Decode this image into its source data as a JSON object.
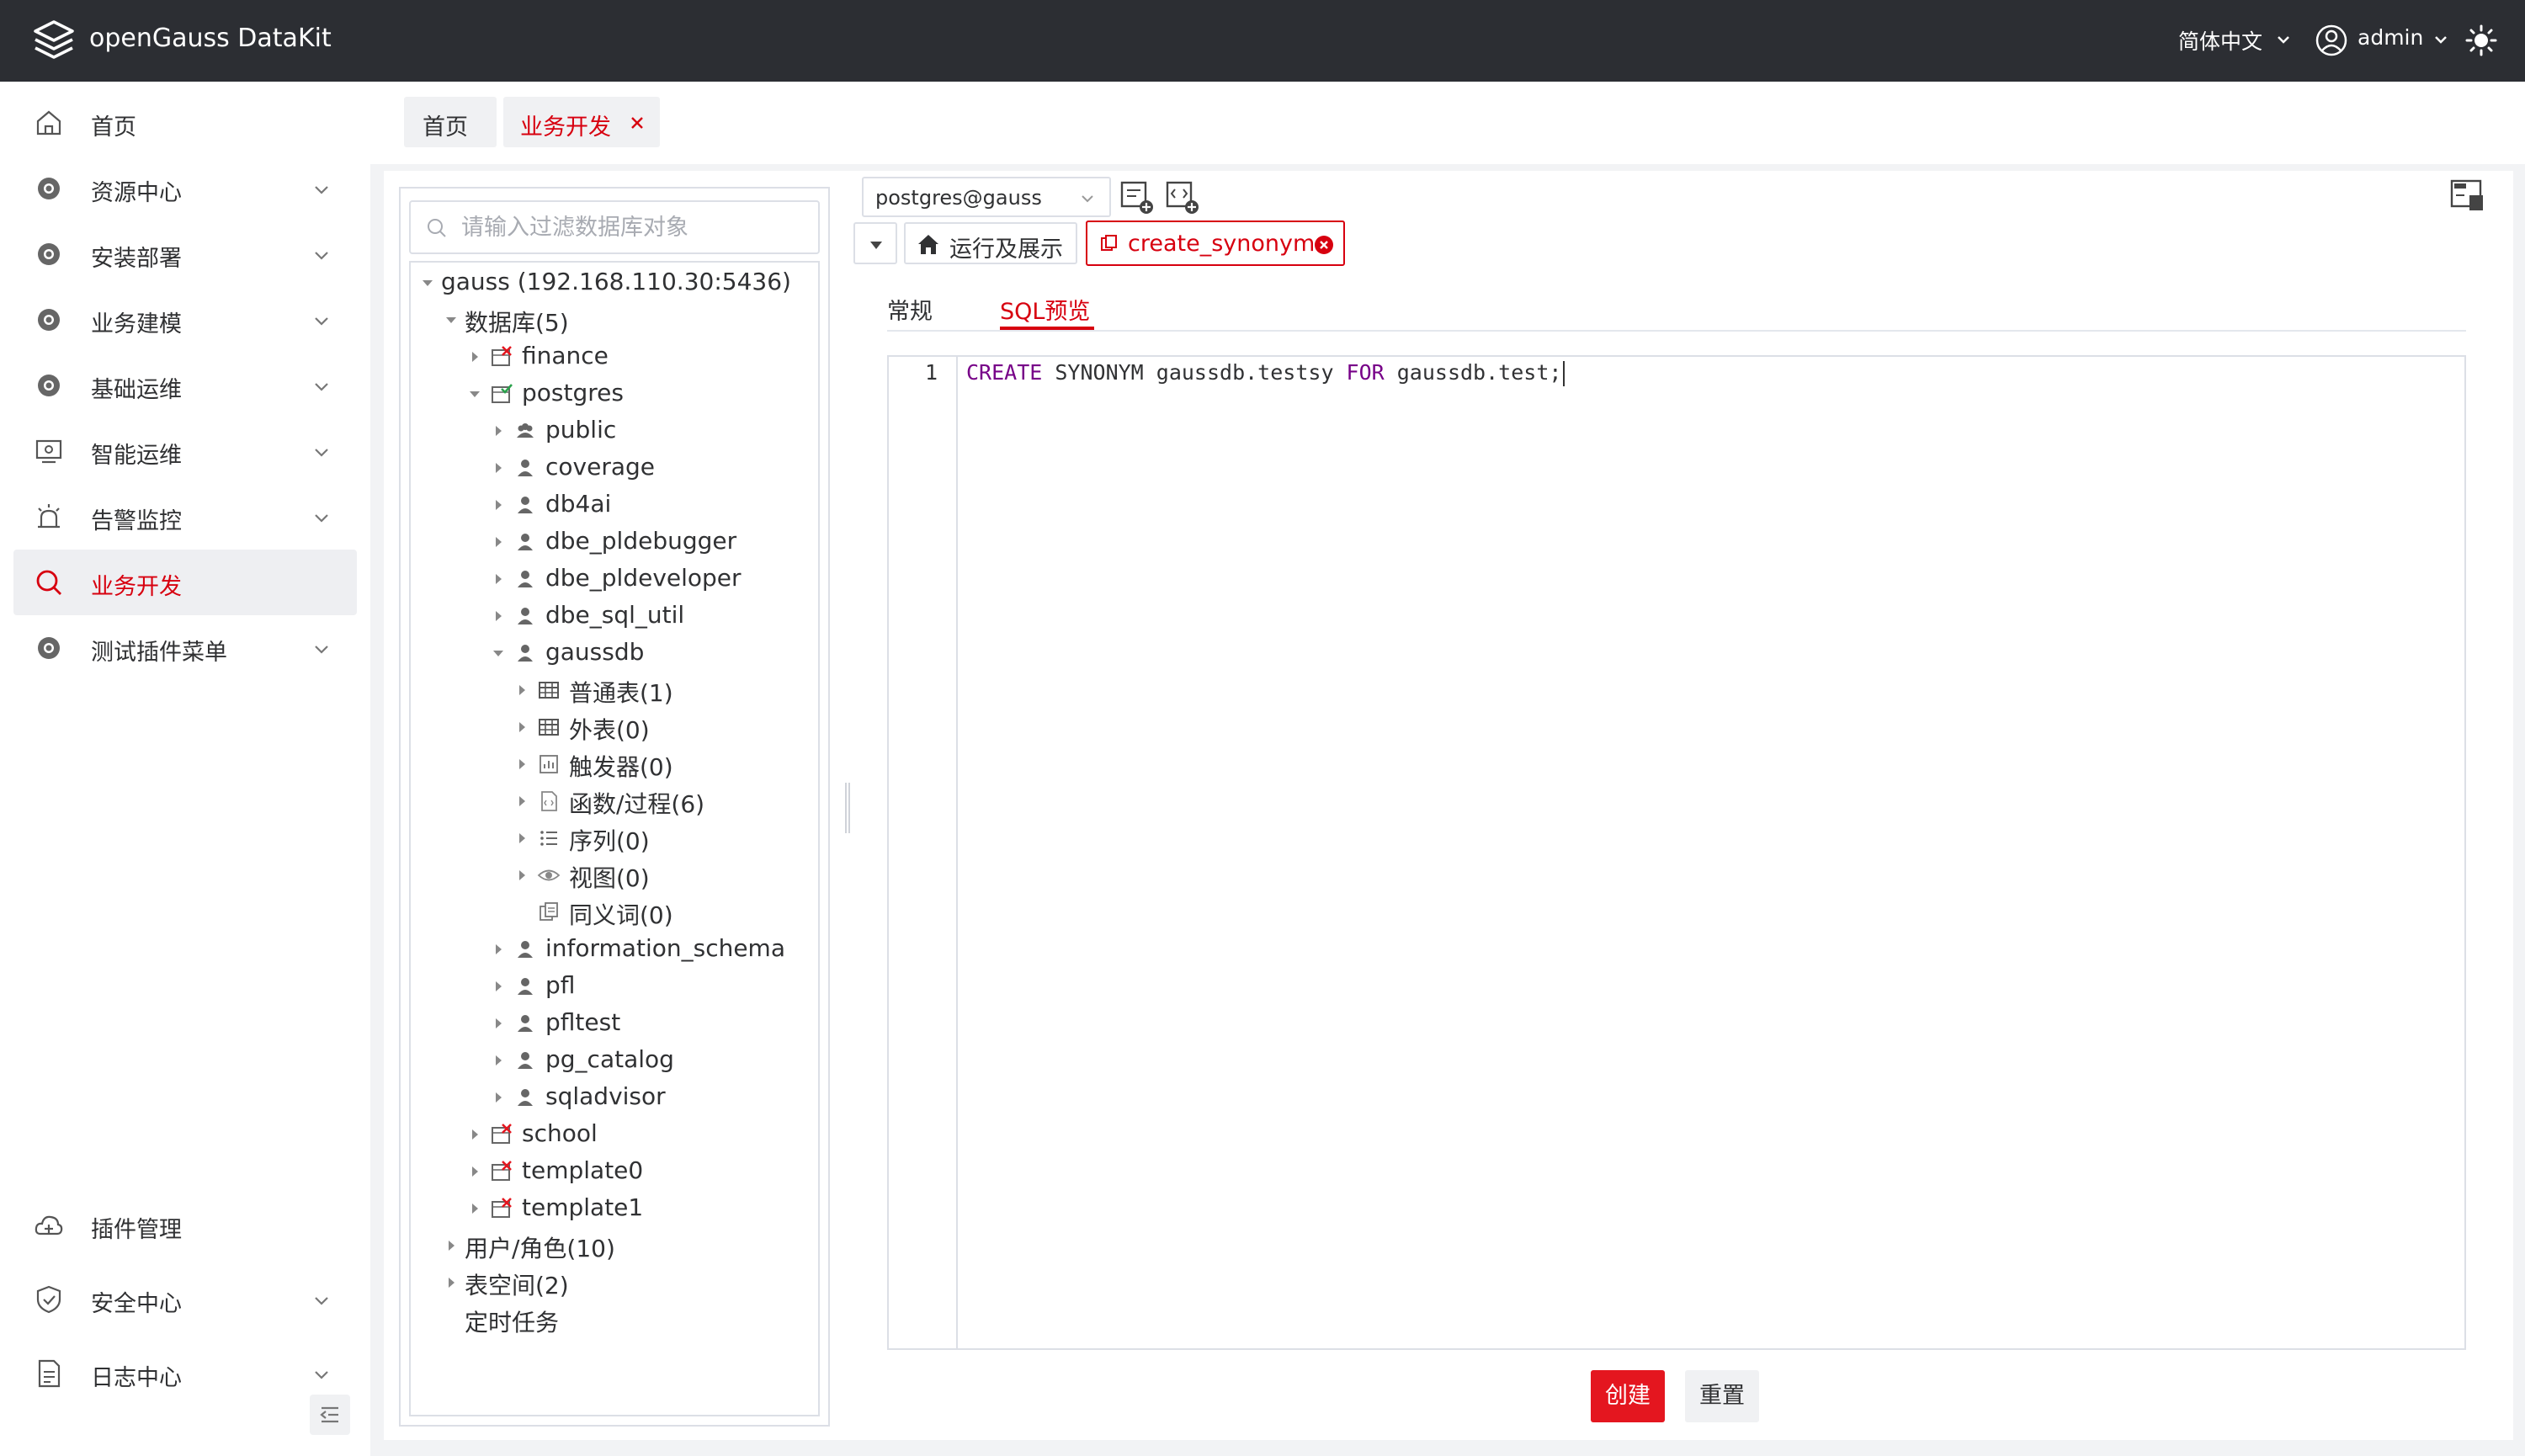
{
  "app": {
    "title": "openGauss DataKit"
  },
  "header": {
    "language": "简体中文",
    "user": "admin"
  },
  "sidebar": {
    "items": [
      {
        "label": "首页",
        "icon": "home-icon"
      },
      {
        "label": "资源中心",
        "icon": "gear-icon"
      },
      {
        "label": "安装部署",
        "icon": "gear-icon"
      },
      {
        "label": "业务建模",
        "icon": "gear-icon"
      },
      {
        "label": "基础运维",
        "icon": "gear-icon"
      },
      {
        "label": "智能运维",
        "icon": "monitor-icon"
      },
      {
        "label": "告警监控",
        "icon": "alarm-icon"
      },
      {
        "label": "业务开发",
        "icon": "search-icon"
      },
      {
        "label": "测试插件菜单",
        "icon": "gear-icon"
      }
    ],
    "bottom_items": [
      {
        "label": "插件管理",
        "icon": "cloud-icon"
      },
      {
        "label": "安全中心",
        "icon": "shield-icon"
      },
      {
        "label": "日志中心",
        "icon": "document-icon"
      }
    ],
    "active": "业务开发"
  },
  "page_tabs": [
    {
      "label": "首页"
    },
    {
      "label": "业务开发"
    }
  ],
  "tree": {
    "search_placeholder": "请输入过滤数据库对象",
    "nodes": [
      {
        "label": "gauss (192.168.110.30:5436)"
      },
      {
        "label": "数据库(5)"
      },
      {
        "label": "finance"
      },
      {
        "label": "postgres"
      },
      {
        "label": "public"
      },
      {
        "label": "coverage"
      },
      {
        "label": "db4ai"
      },
      {
        "label": "dbe_pldebugger"
      },
      {
        "label": "dbe_pldeveloper"
      },
      {
        "label": "dbe_sql_util"
      },
      {
        "label": "gaussdb"
      },
      {
        "label": "普通表(1)"
      },
      {
        "label": "外表(0)"
      },
      {
        "label": "触发器(0)"
      },
      {
        "label": "函数/过程(6)"
      },
      {
        "label": "序列(0)"
      },
      {
        "label": "视图(0)"
      },
      {
        "label": "同义词(0)"
      },
      {
        "label": "information_schema"
      },
      {
        "label": "pfl"
      },
      {
        "label": "pfltest"
      },
      {
        "label": "pg_catalog"
      },
      {
        "label": "sqladvisor"
      },
      {
        "label": "school"
      },
      {
        "label": "template0"
      },
      {
        "label": "template1"
      },
      {
        "label": "用户/角色(10)"
      },
      {
        "label": "表空间(2)"
      },
      {
        "label": "定时任务"
      }
    ]
  },
  "editor": {
    "connection": "postgres@gauss",
    "tabs": {
      "run": "运行及展示",
      "synonym": "create_synonym"
    },
    "sub_tabs": {
      "general": "常规",
      "sql_preview": "SQL预览"
    },
    "line_number": "1",
    "sql": {
      "kw1": "CREATE",
      "rest1": " SYNONYM gaussdb.testsy ",
      "kw2": "FOR",
      "rest2": " gaussdb.test;"
    },
    "buttons": {
      "create": "创建",
      "reset": "重置"
    }
  },
  "colors": {
    "brand": "#d7000f",
    "topbar": "#2c2e33",
    "keyword": "#770088"
  }
}
